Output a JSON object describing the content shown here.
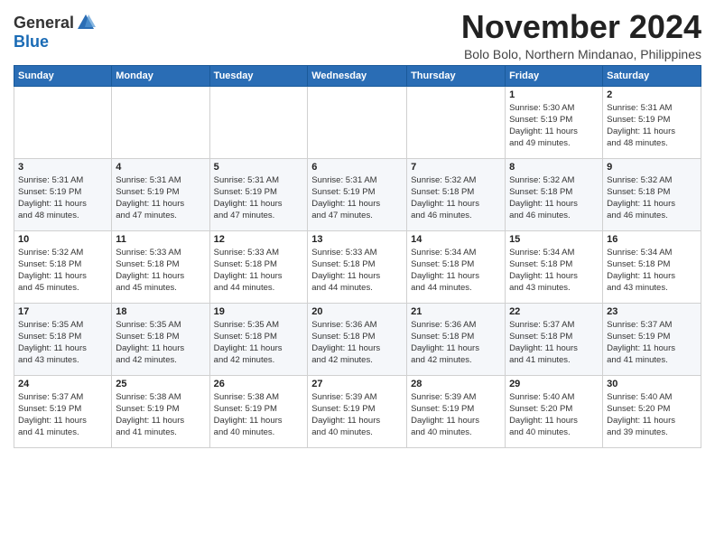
{
  "logo": {
    "general": "General",
    "blue": "Blue"
  },
  "title": "November 2024",
  "location": "Bolo Bolo, Northern Mindanao, Philippines",
  "weekdays": [
    "Sunday",
    "Monday",
    "Tuesday",
    "Wednesday",
    "Thursday",
    "Friday",
    "Saturday"
  ],
  "weeks": [
    [
      {
        "day": "",
        "info": ""
      },
      {
        "day": "",
        "info": ""
      },
      {
        "day": "",
        "info": ""
      },
      {
        "day": "",
        "info": ""
      },
      {
        "day": "",
        "info": ""
      },
      {
        "day": "1",
        "info": "Sunrise: 5:30 AM\nSunset: 5:19 PM\nDaylight: 11 hours\nand 49 minutes."
      },
      {
        "day": "2",
        "info": "Sunrise: 5:31 AM\nSunset: 5:19 PM\nDaylight: 11 hours\nand 48 minutes."
      }
    ],
    [
      {
        "day": "3",
        "info": "Sunrise: 5:31 AM\nSunset: 5:19 PM\nDaylight: 11 hours\nand 48 minutes."
      },
      {
        "day": "4",
        "info": "Sunrise: 5:31 AM\nSunset: 5:19 PM\nDaylight: 11 hours\nand 47 minutes."
      },
      {
        "day": "5",
        "info": "Sunrise: 5:31 AM\nSunset: 5:19 PM\nDaylight: 11 hours\nand 47 minutes."
      },
      {
        "day": "6",
        "info": "Sunrise: 5:31 AM\nSunset: 5:19 PM\nDaylight: 11 hours\nand 47 minutes."
      },
      {
        "day": "7",
        "info": "Sunrise: 5:32 AM\nSunset: 5:18 PM\nDaylight: 11 hours\nand 46 minutes."
      },
      {
        "day": "8",
        "info": "Sunrise: 5:32 AM\nSunset: 5:18 PM\nDaylight: 11 hours\nand 46 minutes."
      },
      {
        "day": "9",
        "info": "Sunrise: 5:32 AM\nSunset: 5:18 PM\nDaylight: 11 hours\nand 46 minutes."
      }
    ],
    [
      {
        "day": "10",
        "info": "Sunrise: 5:32 AM\nSunset: 5:18 PM\nDaylight: 11 hours\nand 45 minutes."
      },
      {
        "day": "11",
        "info": "Sunrise: 5:33 AM\nSunset: 5:18 PM\nDaylight: 11 hours\nand 45 minutes."
      },
      {
        "day": "12",
        "info": "Sunrise: 5:33 AM\nSunset: 5:18 PM\nDaylight: 11 hours\nand 44 minutes."
      },
      {
        "day": "13",
        "info": "Sunrise: 5:33 AM\nSunset: 5:18 PM\nDaylight: 11 hours\nand 44 minutes."
      },
      {
        "day": "14",
        "info": "Sunrise: 5:34 AM\nSunset: 5:18 PM\nDaylight: 11 hours\nand 44 minutes."
      },
      {
        "day": "15",
        "info": "Sunrise: 5:34 AM\nSunset: 5:18 PM\nDaylight: 11 hours\nand 43 minutes."
      },
      {
        "day": "16",
        "info": "Sunrise: 5:34 AM\nSunset: 5:18 PM\nDaylight: 11 hours\nand 43 minutes."
      }
    ],
    [
      {
        "day": "17",
        "info": "Sunrise: 5:35 AM\nSunset: 5:18 PM\nDaylight: 11 hours\nand 43 minutes."
      },
      {
        "day": "18",
        "info": "Sunrise: 5:35 AM\nSunset: 5:18 PM\nDaylight: 11 hours\nand 42 minutes."
      },
      {
        "day": "19",
        "info": "Sunrise: 5:35 AM\nSunset: 5:18 PM\nDaylight: 11 hours\nand 42 minutes."
      },
      {
        "day": "20",
        "info": "Sunrise: 5:36 AM\nSunset: 5:18 PM\nDaylight: 11 hours\nand 42 minutes."
      },
      {
        "day": "21",
        "info": "Sunrise: 5:36 AM\nSunset: 5:18 PM\nDaylight: 11 hours\nand 42 minutes."
      },
      {
        "day": "22",
        "info": "Sunrise: 5:37 AM\nSunset: 5:18 PM\nDaylight: 11 hours\nand 41 minutes."
      },
      {
        "day": "23",
        "info": "Sunrise: 5:37 AM\nSunset: 5:19 PM\nDaylight: 11 hours\nand 41 minutes."
      }
    ],
    [
      {
        "day": "24",
        "info": "Sunrise: 5:37 AM\nSunset: 5:19 PM\nDaylight: 11 hours\nand 41 minutes."
      },
      {
        "day": "25",
        "info": "Sunrise: 5:38 AM\nSunset: 5:19 PM\nDaylight: 11 hours\nand 41 minutes."
      },
      {
        "day": "26",
        "info": "Sunrise: 5:38 AM\nSunset: 5:19 PM\nDaylight: 11 hours\nand 40 minutes."
      },
      {
        "day": "27",
        "info": "Sunrise: 5:39 AM\nSunset: 5:19 PM\nDaylight: 11 hours\nand 40 minutes."
      },
      {
        "day": "28",
        "info": "Sunrise: 5:39 AM\nSunset: 5:19 PM\nDaylight: 11 hours\nand 40 minutes."
      },
      {
        "day": "29",
        "info": "Sunrise: 5:40 AM\nSunset: 5:20 PM\nDaylight: 11 hours\nand 40 minutes."
      },
      {
        "day": "30",
        "info": "Sunrise: 5:40 AM\nSunset: 5:20 PM\nDaylight: 11 hours\nand 39 minutes."
      }
    ]
  ]
}
